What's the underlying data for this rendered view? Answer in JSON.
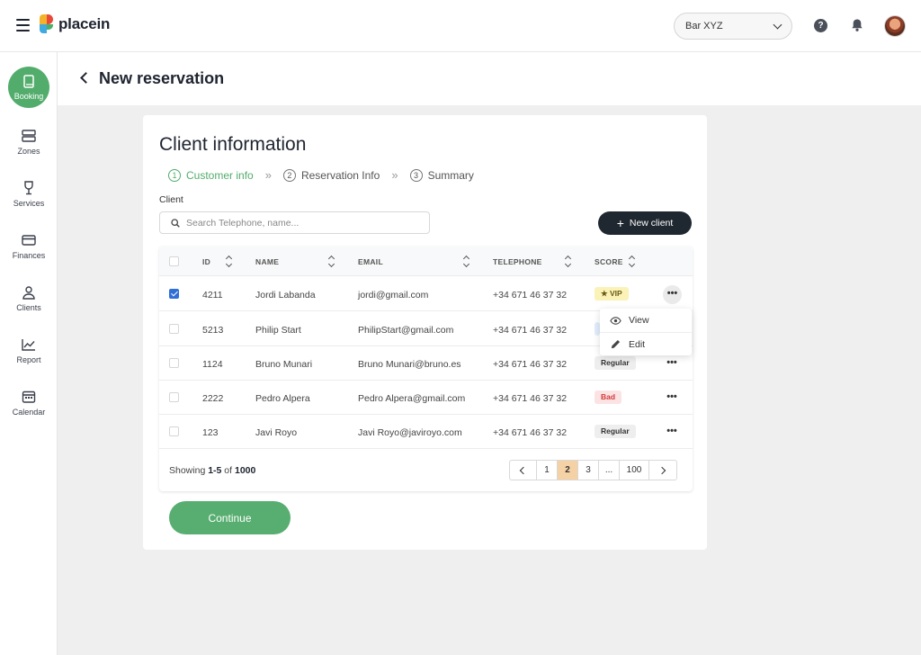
{
  "app": {
    "brand": "placein",
    "venue": "Bar XYZ",
    "help_glyph": "?",
    "icons": [
      "hamburger-icon",
      "help-icon",
      "bell-icon",
      "avatar"
    ]
  },
  "sidebar": {
    "items": [
      {
        "label": "Booking",
        "icon": "book-icon",
        "active": true
      },
      {
        "label": "Zones",
        "icon": "zones-icon"
      },
      {
        "label": "Services",
        "icon": "services-icon"
      },
      {
        "label": "Finances",
        "icon": "card-icon"
      },
      {
        "label": "Clients",
        "icon": "user-icon"
      },
      {
        "label": "Report",
        "icon": "chart-icon"
      },
      {
        "label": "Calendar",
        "icon": "calendar-icon"
      }
    ]
  },
  "header": {
    "title": "New reservation"
  },
  "card": {
    "title": "Client information",
    "steps": [
      {
        "num": "1",
        "label": "Customer info",
        "active": true
      },
      {
        "num": "2",
        "label": "Reservation Info"
      },
      {
        "num": "3",
        "label": "Summary"
      }
    ],
    "step_sep": "»",
    "client_label": "Client",
    "search_placeholder": "Search Telephone, name...",
    "new_client_plus": "+",
    "new_client_label": "New client",
    "columns": [
      "ID",
      "NAME",
      "EMAIL",
      "TELEPHONE",
      "SCORE"
    ],
    "rows": [
      {
        "id": "4211",
        "name": "Jordi Labanda",
        "email": "jordi@gmail.com",
        "phone": "+34 671 46 37 32",
        "score": "★ VIP",
        "score_type": "vip",
        "checked": true
      },
      {
        "id": "5213",
        "name": "Philip Start",
        "email": "PhilipStart@gmail.com",
        "phone": "+34 671 46 37 32",
        "score": "",
        "score_type": "partial",
        "checked": false
      },
      {
        "id": "1124",
        "name": "Bruno Munari",
        "email": "Bruno Munari@bruno.es",
        "phone": "+34 671 46 37 32",
        "score": "Regular",
        "score_type": "regular",
        "checked": false
      },
      {
        "id": "2222",
        "name": "Pedro Alpera",
        "email": "Pedro Alpera@gmail.com",
        "phone": "+34 671 46 37 32",
        "score": "Bad",
        "score_type": "bad",
        "checked": false
      },
      {
        "id": "123",
        "name": "Javi Royo",
        "email": "Javi Royo@javiroyo.com",
        "phone": "+34 671 46 37 32",
        "score": "Regular",
        "score_type": "regular",
        "checked": false
      }
    ],
    "more_glyph": "•••",
    "showing_prefix": "Showing ",
    "showing_range": "1-5",
    "showing_of": " of ",
    "showing_total": "1000",
    "pages": [
      "1",
      "2",
      "3",
      "...",
      "100"
    ],
    "current_page": "2",
    "row_menu": [
      {
        "label": "View",
        "icon": "eye-icon"
      },
      {
        "label": "Edit",
        "icon": "pencil-icon"
      }
    ],
    "continue_label": "Continue"
  },
  "colors": {
    "accent_green": "#52ad6c",
    "dark_button": "#1f2730",
    "active_page": "#f5d1a6",
    "checkbox_blue": "#2f6fd6"
  }
}
